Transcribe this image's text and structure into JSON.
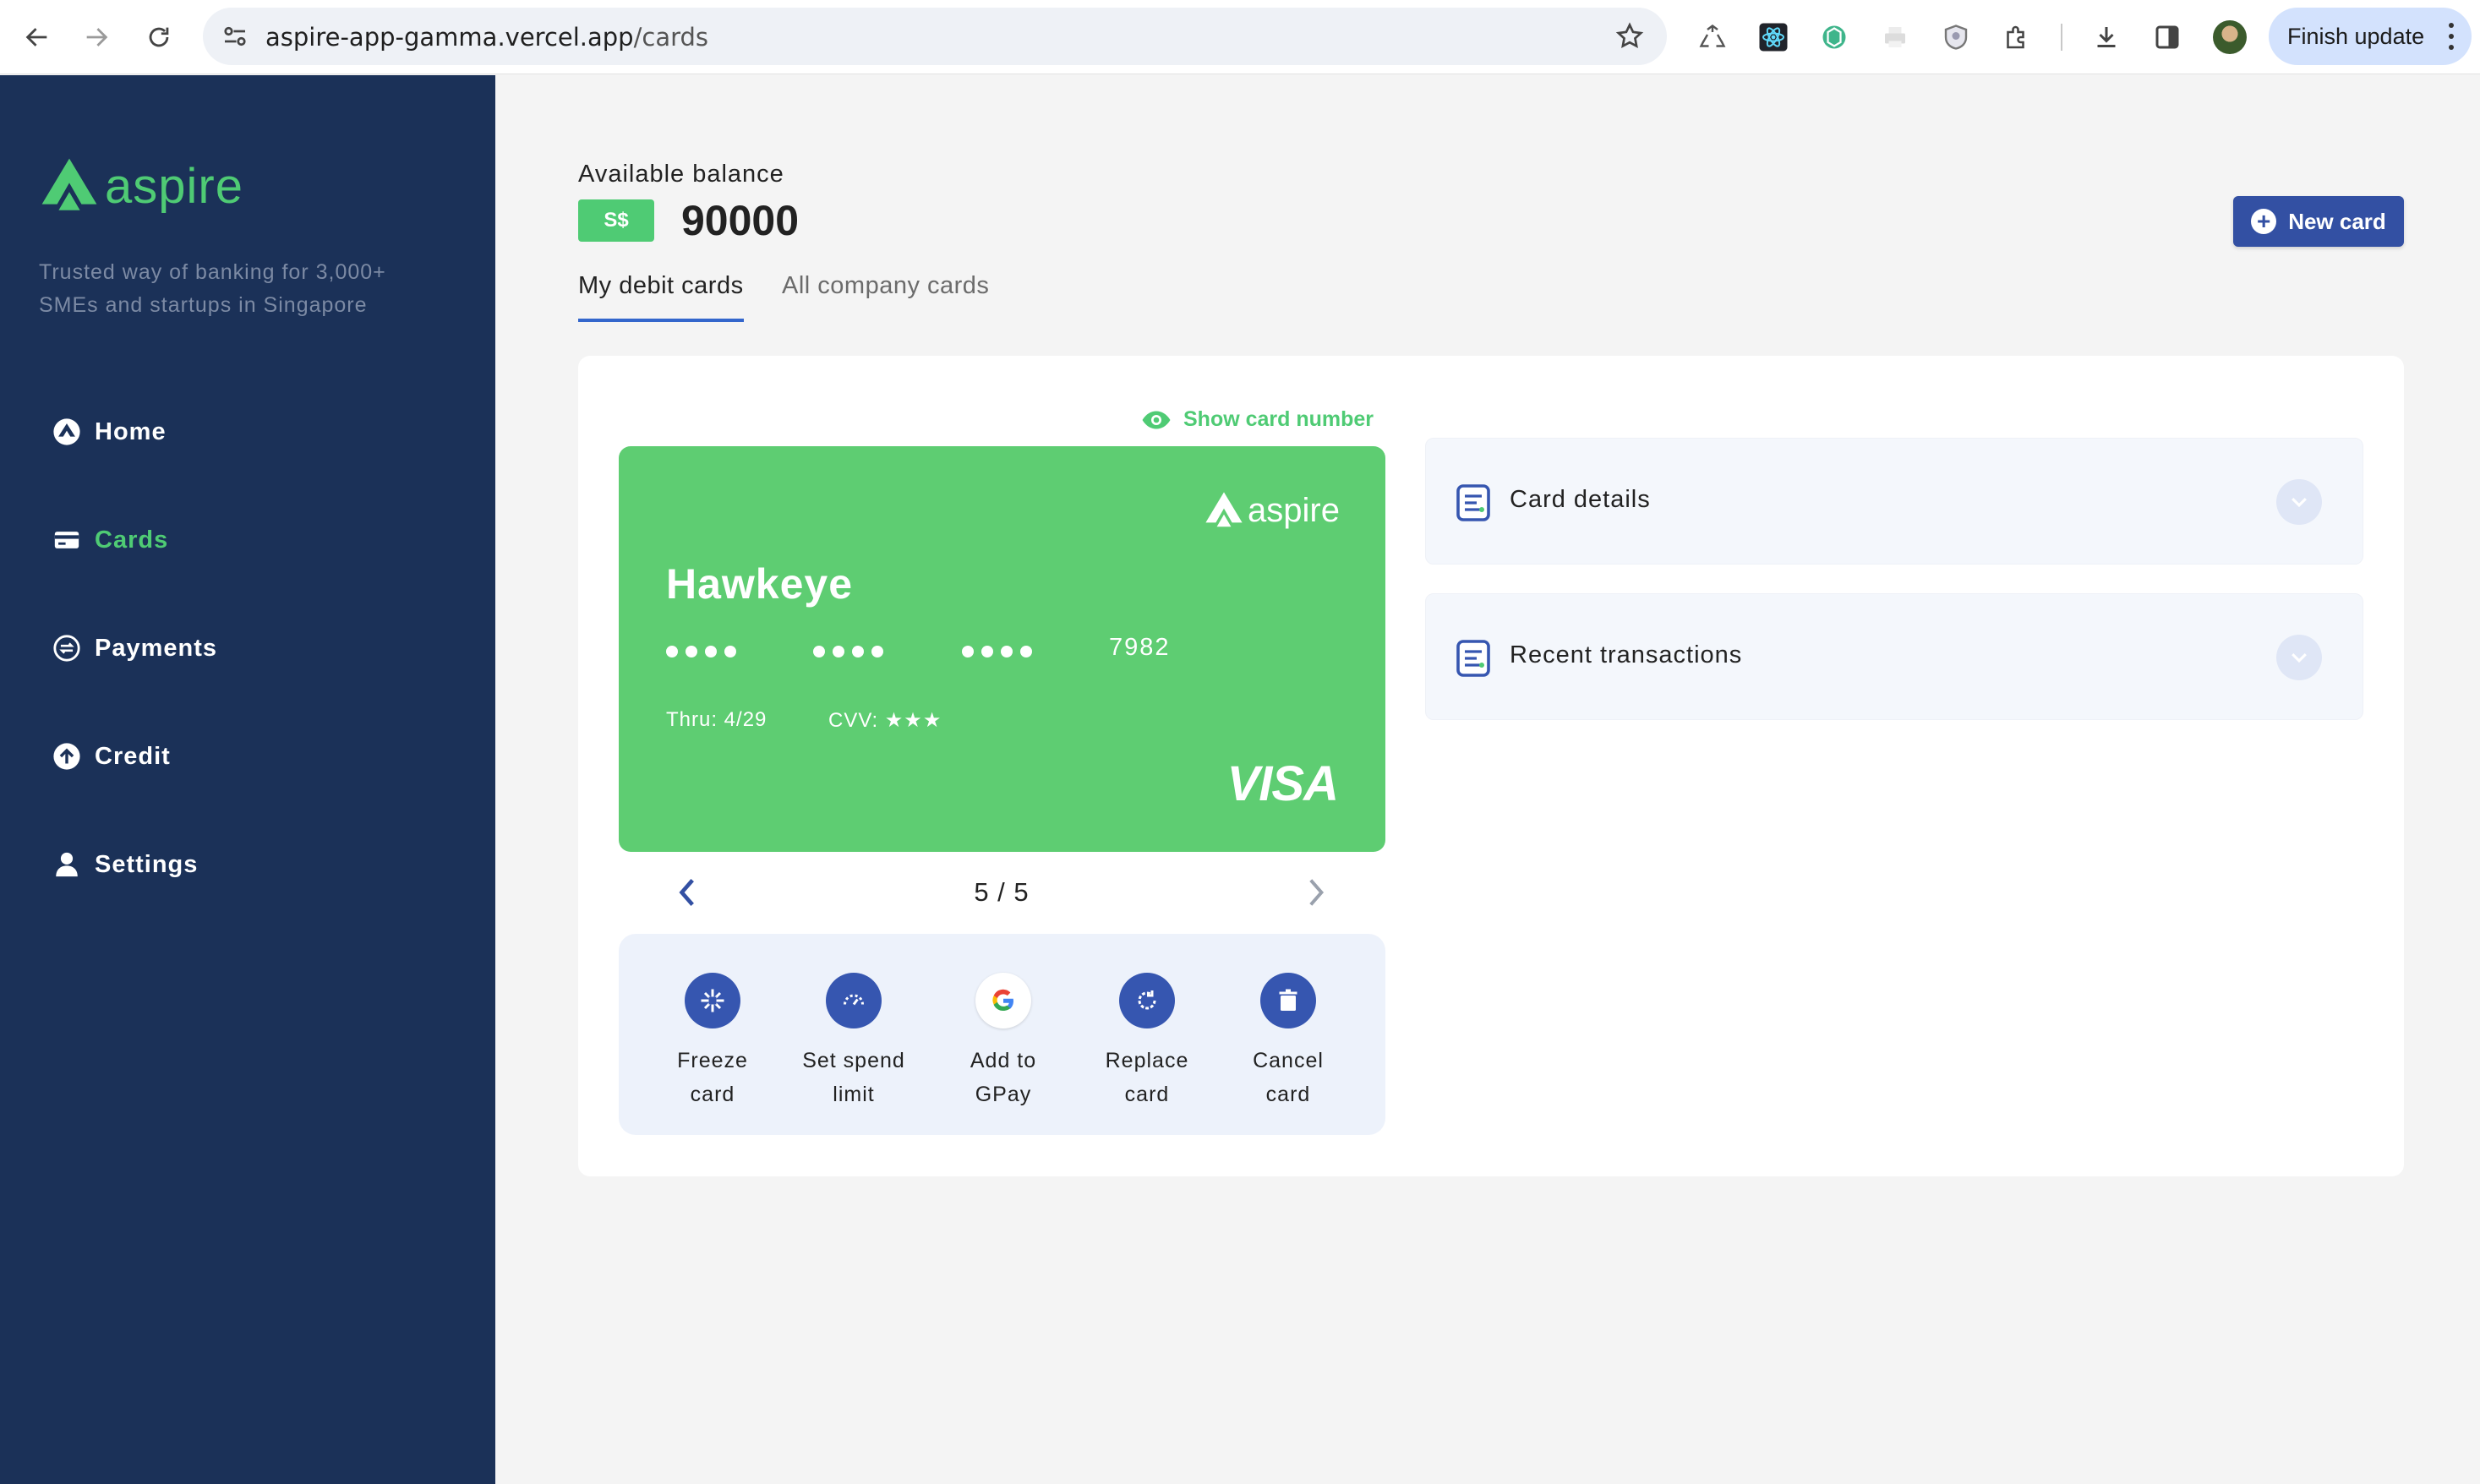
{
  "browser": {
    "url_host": "aspire-app-gamma.vercel.app",
    "url_path": "/cards",
    "finish_update_label": "Finish update"
  },
  "sidebar": {
    "logo_text": "aspire",
    "tagline": "Trusted way of banking for 3,000+ SMEs and startups in Singapore",
    "items": [
      {
        "label": "Home",
        "icon": "aspire-home-icon",
        "active": false
      },
      {
        "label": "Cards",
        "icon": "card-icon",
        "active": true
      },
      {
        "label": "Payments",
        "icon": "payments-icon",
        "active": false
      },
      {
        "label": "Credit",
        "icon": "credit-up-arrow-icon",
        "active": false
      },
      {
        "label": "Settings",
        "icon": "user-icon",
        "active": false
      }
    ]
  },
  "header": {
    "balance_label": "Available balance",
    "currency": "S$",
    "balance": "90000",
    "new_card_label": "New card"
  },
  "tabs": [
    {
      "label": "My debit cards",
      "active": true
    },
    {
      "label": "All company cards",
      "active": false
    }
  ],
  "card": {
    "show_number_label": "Show card number",
    "logo_text": "aspire",
    "holder": "Hawkeye",
    "last4": "7982",
    "thru": "Thru: 4/29",
    "cvv": "CVV: ★★★",
    "brand": "VISA",
    "pager": "5 / 5"
  },
  "actions": [
    {
      "label_line1": "Freeze",
      "label_line2": "card",
      "icon": "snowflake-icon"
    },
    {
      "label_line1": "Set spend",
      "label_line2": "limit",
      "icon": "gauge-icon"
    },
    {
      "label_line1": "Add to",
      "label_line2": "GPay",
      "icon": "google-icon"
    },
    {
      "label_line1": "Replace",
      "label_line2": "card",
      "icon": "refresh-icon"
    },
    {
      "label_line1": "Cancel",
      "label_line2": "card",
      "icon": "trash-icon"
    }
  ],
  "accordions": [
    {
      "title": "Card details"
    },
    {
      "title": "Recent transactions"
    }
  ],
  "colors": {
    "sidebar_bg": "#1b3158",
    "brand_green": "#4fcb74",
    "card_green": "#5ecd72",
    "primary_blue": "#3350a3"
  }
}
